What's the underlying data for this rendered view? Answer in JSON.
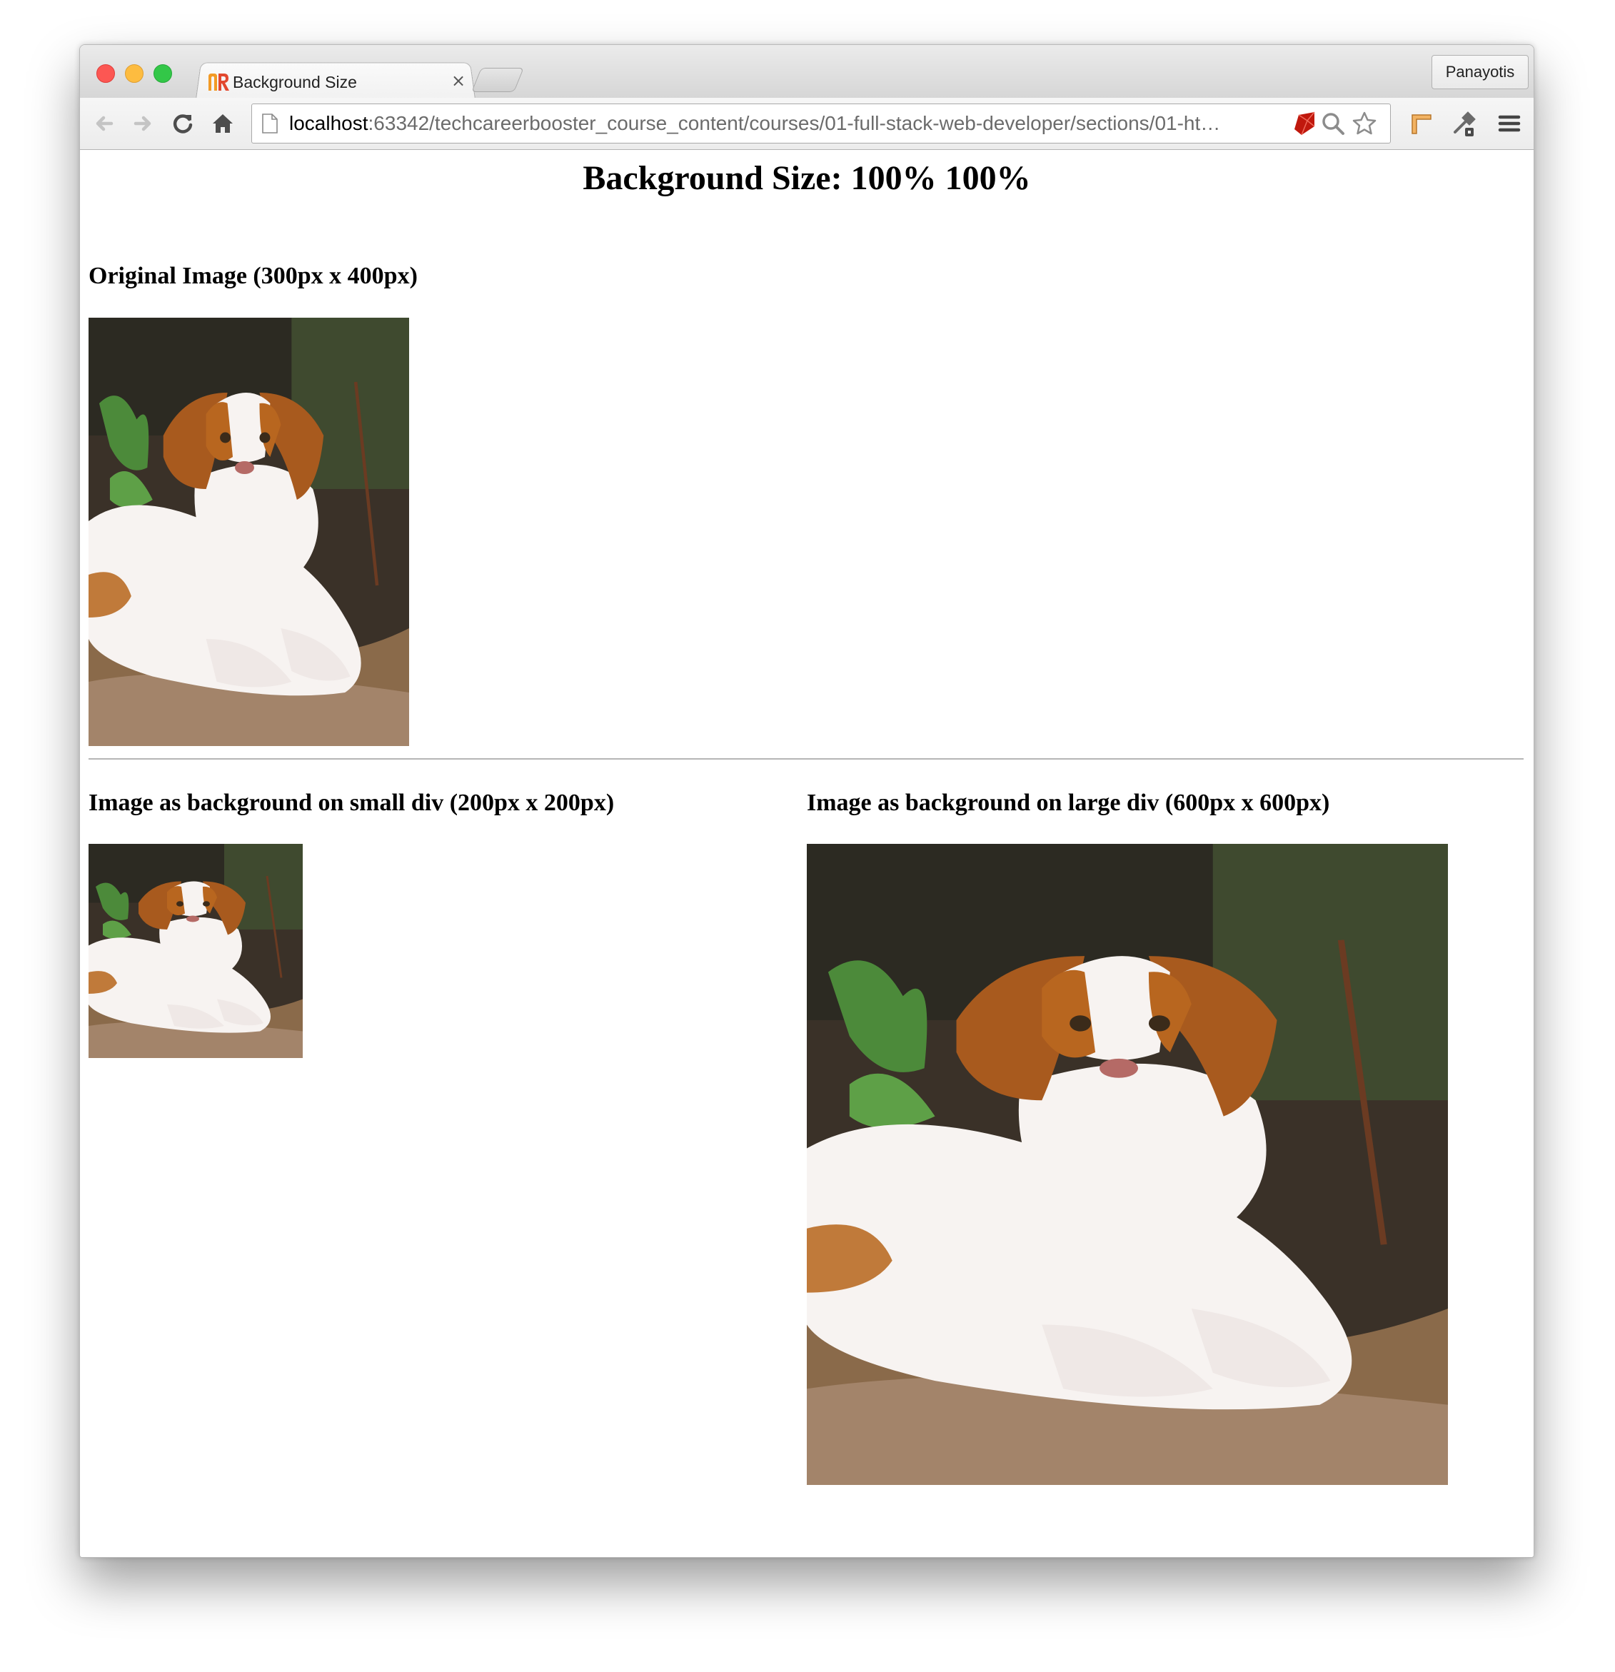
{
  "browser": {
    "tab": {
      "title": "Background Size",
      "close_glyph": "×"
    },
    "profile_label": "Panayotis",
    "address": {
      "host": "localhost",
      "path": ":63342/techcareerbooster_course_content/courses/01-full-stack-web-developer/sections/01-ht…"
    },
    "icons": {
      "back": "back-arrow-icon",
      "forward": "forward-arrow-icon",
      "reload": "reload-icon",
      "home": "home-icon",
      "page": "page-document-icon",
      "ruby": "ruby-extension-icon",
      "zoom": "magnifier-icon",
      "bookmark": "star-icon",
      "ext1": "ruler-extension-icon",
      "ext2": "eyedropper-extension-icon",
      "menu": "hamburger-menu-icon"
    }
  },
  "page": {
    "title": "Background Size: 100% 100%",
    "original_heading": "Original Image (300px x 400px)",
    "small_heading": "Image as background on small div (200px x 200px)",
    "large_heading": "Image as background on large div (600px x 600px)",
    "image_subject": "puppy-photo"
  },
  "colors": {
    "close": "#fc5753",
    "minimize": "#fdbc40",
    "maximize": "#33c748",
    "divider": "#b5b5b5"
  }
}
